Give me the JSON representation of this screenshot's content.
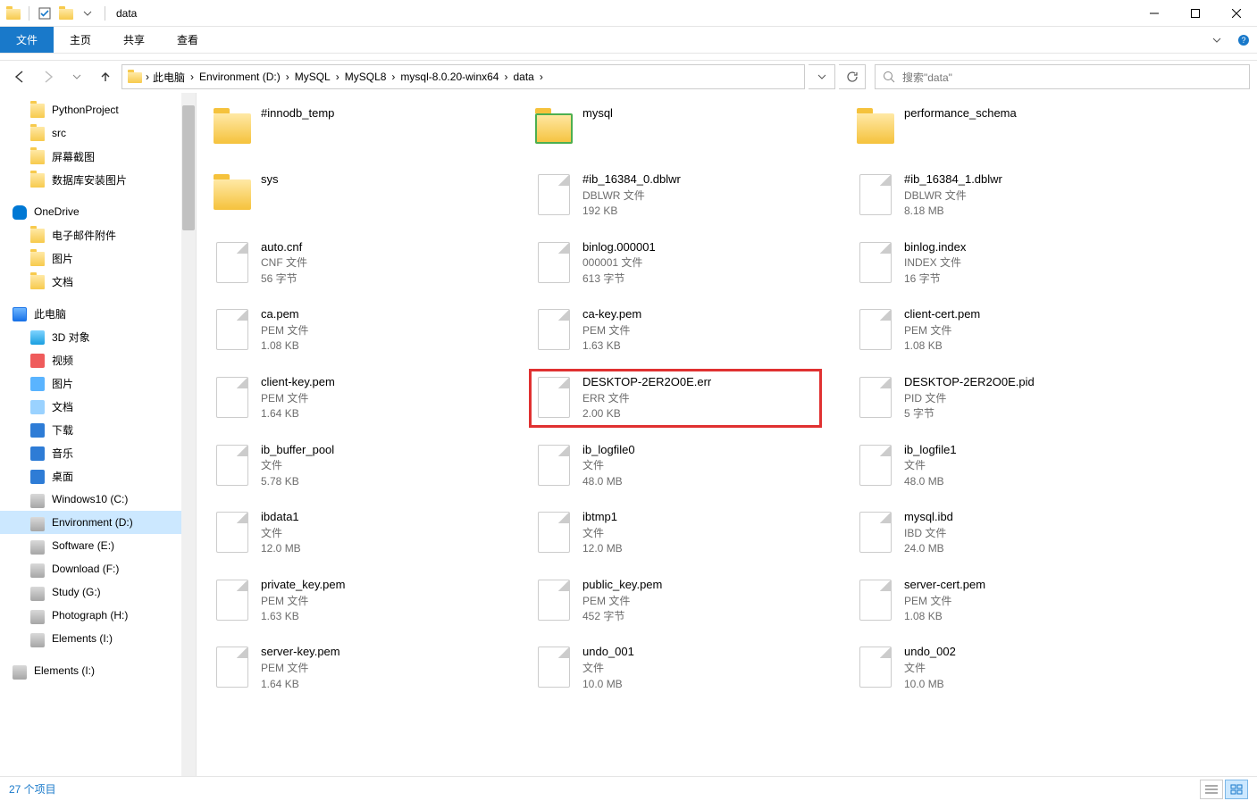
{
  "window": {
    "title": "data"
  },
  "ribbon": {
    "file": "文件",
    "home": "主页",
    "share": "共享",
    "view": "查看"
  },
  "breadcrumbs": [
    "此电脑",
    "Environment (D:)",
    "MySQL",
    "MySQL8",
    "mysql-8.0.20-winx64",
    "data"
  ],
  "search": {
    "placeholder": "搜索\"data\""
  },
  "sidebar": {
    "top": [
      {
        "label": "PythonProject",
        "icon": "folder"
      },
      {
        "label": "src",
        "icon": "folder"
      },
      {
        "label": "屏幕截图",
        "icon": "folder"
      },
      {
        "label": "数据库安装图片",
        "icon": "folder"
      }
    ],
    "onedrive": {
      "label": "OneDrive",
      "children": [
        {
          "label": "电子邮件附件",
          "icon": "folder"
        },
        {
          "label": "图片",
          "icon": "folder"
        },
        {
          "label": "文档",
          "icon": "folder"
        }
      ]
    },
    "pc": {
      "label": "此电脑",
      "children": [
        {
          "label": "3D 对象",
          "icon": "cube"
        },
        {
          "label": "视频",
          "icon": "vid"
        },
        {
          "label": "图片",
          "icon": "pic"
        },
        {
          "label": "文档",
          "icon": "doc"
        },
        {
          "label": "下载",
          "icon": "dl"
        },
        {
          "label": "音乐",
          "icon": "mus"
        },
        {
          "label": "桌面",
          "icon": "desk"
        },
        {
          "label": "Windows10 (C:)",
          "icon": "drive"
        },
        {
          "label": "Environment (D:)",
          "icon": "drive",
          "selected": true
        },
        {
          "label": "Software (E:)",
          "icon": "drive"
        },
        {
          "label": "Download (F:)",
          "icon": "drive"
        },
        {
          "label": "Study (G:)",
          "icon": "drive"
        },
        {
          "label": "Photograph (H:)",
          "icon": "drive"
        },
        {
          "label": "Elements (I:)",
          "icon": "drive"
        }
      ]
    },
    "bottom": [
      {
        "label": "Elements (I:)",
        "icon": "drive"
      }
    ]
  },
  "items": [
    {
      "name": "#innodb_temp",
      "type": "folder"
    },
    {
      "name": "mysql",
      "type": "folder",
      "mark": true
    },
    {
      "name": "performance_schema",
      "type": "folder"
    },
    {
      "name": "sys",
      "type": "folder"
    },
    {
      "name": "#ib_16384_0.dblwr",
      "type": "file",
      "line2": "DBLWR 文件",
      "line3": "192 KB"
    },
    {
      "name": "#ib_16384_1.dblwr",
      "type": "file",
      "line2": "DBLWR 文件",
      "line3": "8.18 MB"
    },
    {
      "name": "auto.cnf",
      "type": "file",
      "line2": "CNF 文件",
      "line3": "56 字节"
    },
    {
      "name": "binlog.000001",
      "type": "file",
      "line2": "000001 文件",
      "line3": "613 字节"
    },
    {
      "name": "binlog.index",
      "type": "file",
      "line2": "INDEX 文件",
      "line3": "16 字节"
    },
    {
      "name": "ca.pem",
      "type": "file",
      "line2": "PEM 文件",
      "line3": "1.08 KB"
    },
    {
      "name": "ca-key.pem",
      "type": "file",
      "line2": "PEM 文件",
      "line3": "1.63 KB"
    },
    {
      "name": "client-cert.pem",
      "type": "file",
      "line2": "PEM 文件",
      "line3": "1.08 KB"
    },
    {
      "name": "client-key.pem",
      "type": "file",
      "line2": "PEM 文件",
      "line3": "1.64 KB"
    },
    {
      "name": "DESKTOP-2ER2O0E.err",
      "type": "file",
      "line2": "ERR 文件",
      "line3": "2.00 KB",
      "highlight": true
    },
    {
      "name": "DESKTOP-2ER2O0E.pid",
      "type": "file",
      "line2": "PID 文件",
      "line3": "5 字节"
    },
    {
      "name": "ib_buffer_pool",
      "type": "file",
      "line2": "文件",
      "line3": "5.78 KB"
    },
    {
      "name": "ib_logfile0",
      "type": "file",
      "line2": "文件",
      "line3": "48.0 MB"
    },
    {
      "name": "ib_logfile1",
      "type": "file",
      "line2": "文件",
      "line3": "48.0 MB"
    },
    {
      "name": "ibdata1",
      "type": "file",
      "line2": "文件",
      "line3": "12.0 MB"
    },
    {
      "name": "ibtmp1",
      "type": "file",
      "line2": "文件",
      "line3": "12.0 MB"
    },
    {
      "name": "mysql.ibd",
      "type": "file",
      "line2": "IBD 文件",
      "line3": "24.0 MB"
    },
    {
      "name": "private_key.pem",
      "type": "file",
      "line2": "PEM 文件",
      "line3": "1.63 KB"
    },
    {
      "name": "public_key.pem",
      "type": "file",
      "line2": "PEM 文件",
      "line3": "452 字节"
    },
    {
      "name": "server-cert.pem",
      "type": "file",
      "line2": "PEM 文件",
      "line3": "1.08 KB"
    },
    {
      "name": "server-key.pem",
      "type": "file",
      "line2": "PEM 文件",
      "line3": "1.64 KB"
    },
    {
      "name": "undo_001",
      "type": "file",
      "line2": "文件",
      "line3": "10.0 MB"
    },
    {
      "name": "undo_002",
      "type": "file",
      "line2": "文件",
      "line3": "10.0 MB"
    }
  ],
  "status": {
    "count": "27 个项目"
  }
}
